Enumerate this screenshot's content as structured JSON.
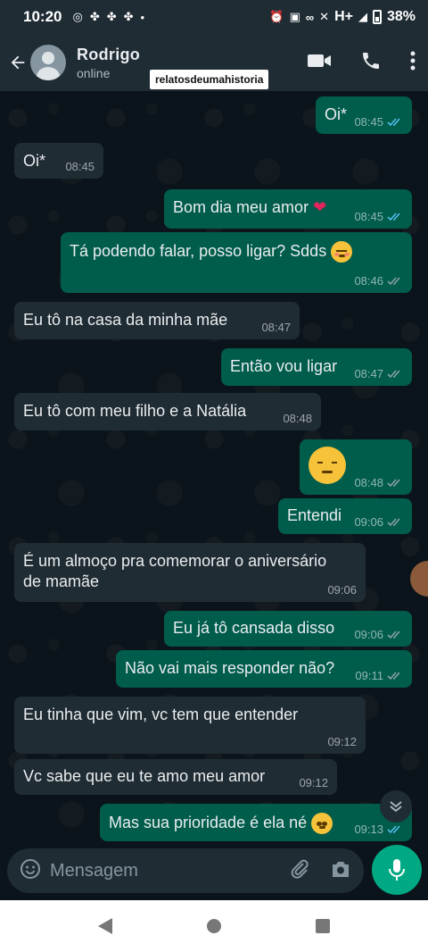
{
  "status_bar": {
    "time": "10:20",
    "network": "H+",
    "battery": "38%"
  },
  "header": {
    "name": "Rodrigo",
    "status": "online",
    "watermark": "relatosdeumahistoria"
  },
  "messages": [
    {
      "dir": "out",
      "text": "Oi*",
      "time": "08:45"
    },
    {
      "dir": "in",
      "text": "Oi*",
      "time": "08:45"
    },
    {
      "dir": "out",
      "text": "Bom dia meu amor",
      "emoji": "heart",
      "time": "08:45"
    },
    {
      "dir": "out",
      "text": "Tá podendo falar, posso ligar? Sdds",
      "emoji": "smiling-face-with-hearts",
      "time": "08:46"
    },
    {
      "dir": "in",
      "text": "Eu tô na casa da minha mãe",
      "time": "08:47"
    },
    {
      "dir": "out",
      "text": "Então vou ligar",
      "time": "08:47"
    },
    {
      "dir": "in",
      "text": "Eu tô com meu filho e a Natália",
      "time": "08:48"
    },
    {
      "dir": "out",
      "text": "",
      "emoji": "unamused-face",
      "time": "08:48"
    },
    {
      "dir": "out",
      "text": "Entendi",
      "time": "09:06"
    },
    {
      "dir": "in",
      "text": "É um almoço pra comemorar o aniversário",
      "text2": "de mamãe",
      "time": "09:06"
    },
    {
      "dir": "out",
      "text": "Eu já tô cansada disso",
      "time": "09:06"
    },
    {
      "dir": "out",
      "text": "Não vai mais responder não?",
      "time": "09:11"
    },
    {
      "dir": "in",
      "text": "Eu tinha que vim, vc tem que entender",
      "time": "09:12"
    },
    {
      "dir": "in",
      "text": "Vc sabe que eu te amo meu amor",
      "time": "09:12"
    },
    {
      "dir": "out",
      "text": "Mas sua prioridade é ela né",
      "emoji": "pleading-face",
      "time": "09:13"
    }
  ],
  "composer": {
    "placeholder": "Mensagem"
  },
  "colors": {
    "outgoing": "#005c4b",
    "incoming": "#202c33",
    "accent": "#00a884",
    "read_tick": "#53bdeb"
  }
}
